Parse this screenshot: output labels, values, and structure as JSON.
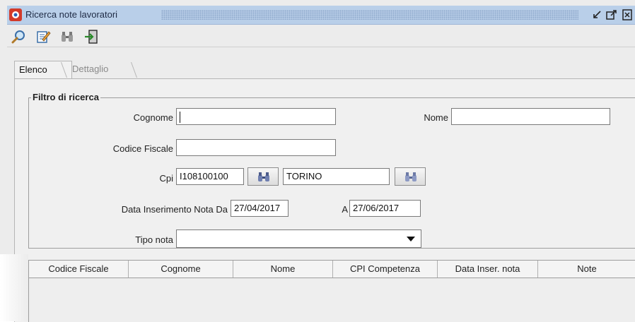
{
  "window": {
    "title": "Ricerca note lavoratori",
    "controls": [
      "restore-icon",
      "maximize-icon",
      "close-icon"
    ]
  },
  "toolbar": {
    "tools": [
      "search-icon",
      "edit-icon",
      "binoculars-icon",
      "exit-icon"
    ]
  },
  "tabs": [
    {
      "label": "Elenco",
      "active": true
    },
    {
      "label": "Dettaglio",
      "active": false
    }
  ],
  "filter": {
    "legend": "Filtro di ricerca",
    "cognome_label": "Cognome",
    "cognome_value": "",
    "nome_label": "Nome",
    "nome_value": "",
    "codice_fiscale_label": "Codice Fiscale",
    "codice_fiscale_value": "",
    "cpi_label": "Cpi",
    "cpi_code_value": "I108100100",
    "cpi_name_value": "TORINO",
    "data_da_label": "Data Inserimento Nota Da",
    "data_da_value": "27/04/2017",
    "data_a_label": "A",
    "data_a_value": "27/06/2017",
    "tipo_nota_label": "Tipo nota",
    "tipo_nota_value": ""
  },
  "table": {
    "columns": [
      "Codice Fiscale",
      "Cognome",
      "Nome",
      "CPI Competenza",
      "Data Inser. nota",
      "Note"
    ],
    "rows": []
  },
  "colors": {
    "titlebar": "#b9cfe9",
    "window_bg": "#ececec",
    "panel_bg": "#f0f0f0"
  }
}
